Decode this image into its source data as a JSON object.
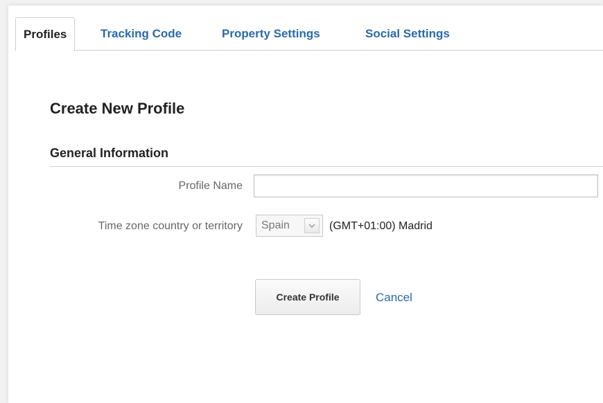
{
  "tabs": [
    {
      "label": "Profiles",
      "active": true
    },
    {
      "label": "Tracking Code",
      "active": false
    },
    {
      "label": "Property Settings",
      "active": false
    },
    {
      "label": "Social Settings",
      "active": false
    }
  ],
  "page": {
    "title": "Create New Profile",
    "section_title": "General Information"
  },
  "form": {
    "profile_name": {
      "label": "Profile Name",
      "value": ""
    },
    "timezone": {
      "label": "Time zone country or territory",
      "selected_country": "Spain",
      "timezone_text": "(GMT+01:00) Madrid"
    }
  },
  "actions": {
    "create_label": "Create Profile",
    "cancel_label": "Cancel"
  },
  "colors": {
    "link": "#2a6aab",
    "text": "#222222",
    "muted": "#666666",
    "border": "#cfcfcf"
  },
  "icons": {
    "dropdown": "chevron-down-icon"
  }
}
